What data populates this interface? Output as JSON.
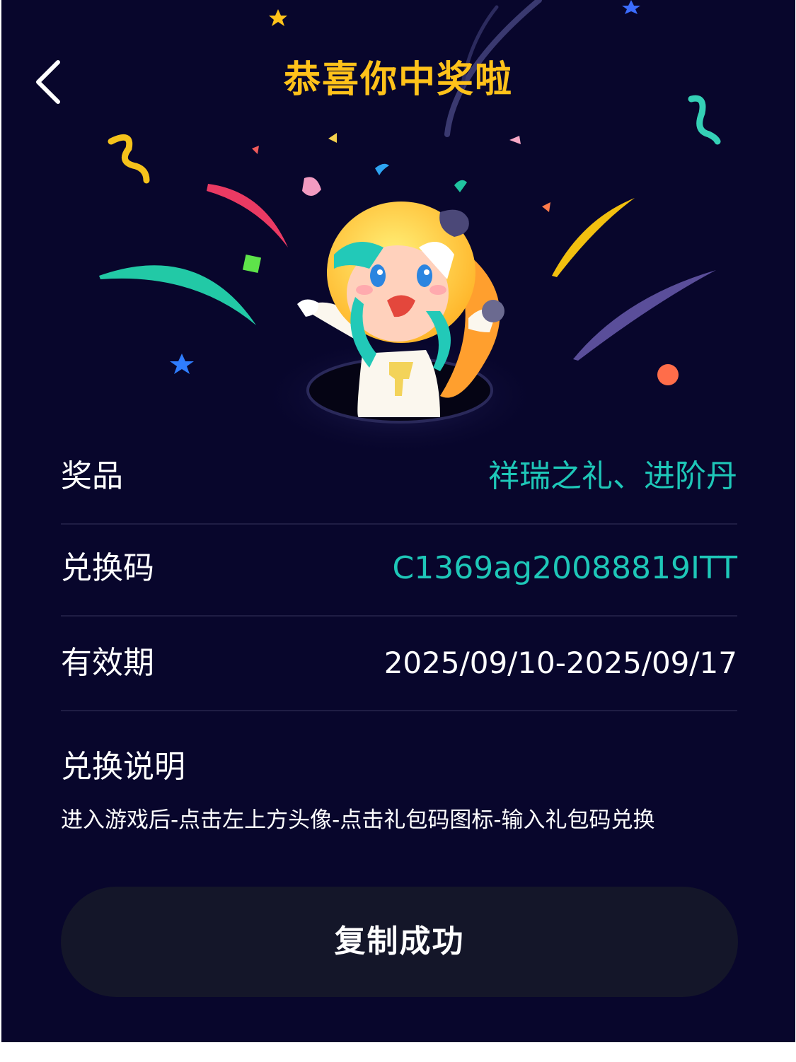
{
  "header": {
    "title": "恭喜你中奖啦",
    "back_icon": "chevron-left-icon",
    "title_color": "#ffc21a"
  },
  "hero": {
    "illustration": "mascot-character-popping-from-hole",
    "confetti_icon": "confetti-icon",
    "star_icon": "star-icon"
  },
  "details": {
    "prize": {
      "label": "奖品",
      "value": "祥瑞之礼、进阶丹"
    },
    "code": {
      "label": "兑换码",
      "value": "C1369ag20088819ITT"
    },
    "validity": {
      "label": "有效期",
      "value": "2025/09/10-2025/09/17"
    }
  },
  "instructions": {
    "title": "兑换说明",
    "text": "进入游戏后-点击左上方头像-点击礼包码图标-输入礼包码兑换"
  },
  "action": {
    "copy_button_label": "复制成功"
  },
  "colors": {
    "background": "#08062c",
    "accent_teal": "#1ec7b8",
    "accent_yellow": "#ffc21a",
    "button_bg": "#141629"
  }
}
